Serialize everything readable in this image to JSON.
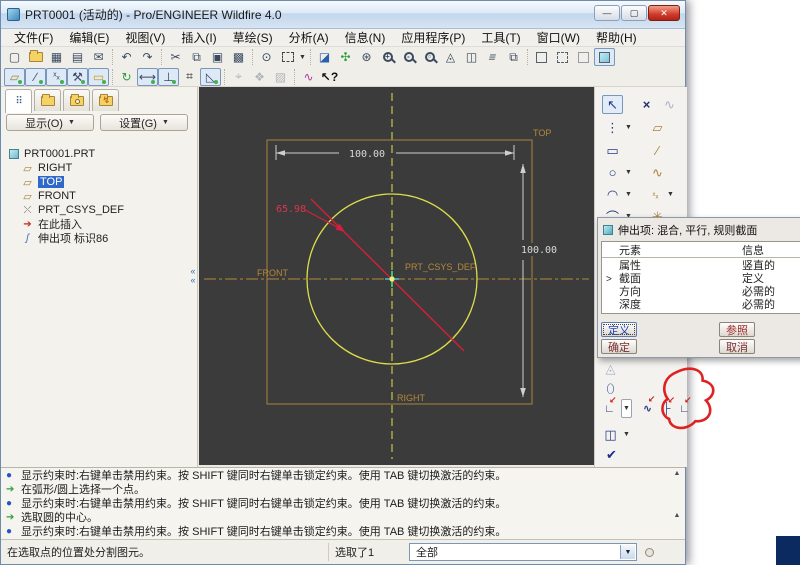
{
  "window": {
    "title": "PRT0001 (活动的) - Pro/ENGINEER Wildfire 4.0"
  },
  "menu": {
    "items": [
      "文件(F)",
      "编辑(E)",
      "视图(V)",
      "插入(I)",
      "草绘(S)",
      "分析(A)",
      "信息(N)",
      "应用程序(P)",
      "工具(T)",
      "窗口(W)",
      "帮助(H)"
    ]
  },
  "toolbar_main": {
    "icons": [
      "new",
      "open",
      "save",
      "print",
      "send-mail",
      "undo",
      "redo",
      "cut",
      "copy",
      "paste",
      "paste-special",
      "find",
      "select-box",
      "repaint",
      "spin-center",
      "pick-from-list",
      "zoom-in",
      "zoom-out",
      "refit",
      "reorient",
      "saved-views",
      "layers",
      "view-manager",
      "wireframe",
      "hidden-line",
      "no-hidden",
      "shaded"
    ]
  },
  "toolbar_datum": {
    "icons": [
      "datum-planes-toggle",
      "datum-axes-toggle",
      "datum-points-toggle",
      "csys-toggle",
      "annotation-toggle",
      "sketch-orient",
      "dimension-display-toggle",
      "constraint-display-toggle",
      "grid-toggle",
      "vertex-display-toggle",
      "disabled-tool-1",
      "disabled-tool-2",
      "disabled-tool-3",
      "sketcher-palette",
      "context-help"
    ]
  },
  "navigator": {
    "tabs": [
      "model-tree",
      "folder-browser",
      "favorites",
      "connections"
    ],
    "show_button": "显示(O)",
    "settings_button": "设置(G)",
    "tree": [
      {
        "label": "PRT0001.PRT",
        "icon": "part"
      },
      {
        "label": "RIGHT",
        "icon": "datum-plane"
      },
      {
        "label": "TOP",
        "icon": "datum-plane",
        "selected": true
      },
      {
        "label": "FRONT",
        "icon": "datum-plane"
      },
      {
        "label": "PRT_CSYS_DEF",
        "icon": "csys"
      },
      {
        "label": "在此插入",
        "icon": "insert-here"
      },
      {
        "label": "伸出项 标识86",
        "icon": "protrusion"
      }
    ]
  },
  "sketch": {
    "dim_width": "100.00",
    "dim_height": "100.00",
    "dim_diagonal": "65.98",
    "label_top": "TOP",
    "label_front": "FRONT",
    "label_right": "RIGHT",
    "label_csys": "PRT_CSYS_DEF",
    "colors": {
      "background": "#3b3b3b",
      "sketch_yellow": "#dede4a",
      "reference_orange": "#a8833e",
      "dimension_gray": "#d9d9d9",
      "highlight_red": "#d41f3c"
    }
  },
  "sketcher_toolbar": {
    "icons": [
      "select",
      "delete-segment",
      "spline-disabled",
      "line",
      "datum-plane",
      "rectangle",
      "datum-axis",
      "circle",
      "spline",
      "arc",
      "datum-points",
      "fillet",
      "axis-point",
      "text-disabled",
      "ellipse",
      "trim",
      "trim-delete-segment",
      "trim-corner",
      "trim-divide",
      "mirror",
      "accept"
    ]
  },
  "dialog": {
    "title": "伸出项: 混合, 平行, 规则截面",
    "columns": {
      "element": "元素",
      "info": "信息"
    },
    "rows": [
      {
        "element": "属性",
        "info": "竖直的",
        "marker": ""
      },
      {
        "element": "截面",
        "info": "定义",
        "marker": ">"
      },
      {
        "element": "方向",
        "info": "必需的",
        "marker": ""
      },
      {
        "element": "深度",
        "info": "必需的",
        "marker": ""
      }
    ],
    "buttons": {
      "define": "定义",
      "refs": "参照",
      "ok": "确定",
      "cancel": "取消"
    }
  },
  "messages": {
    "lines": [
      {
        "bullet": "dot",
        "text": "显示约束时:右键单击禁用约束。按 SHIFT 键同时右键单击锁定约束。使用 TAB 键切换激活的约束。"
      },
      {
        "bullet": "arrow",
        "text": "在弧形/圆上选择一个点。"
      },
      {
        "bullet": "dot",
        "text": "显示约束时:右键单击禁用约束。按 SHIFT 键同时右键单击锁定约束。使用 TAB 键切换激活的约束。"
      },
      {
        "bullet": "arrow",
        "text": "选取圆的中心。"
      },
      {
        "bullet": "dot",
        "text": "显示约束时:右键单击禁用约束。按 SHIFT 键同时右键单击锁定约束。使用 TAB 键切换激活的约束。"
      }
    ]
  },
  "statusbar": {
    "message": "在选取点的位置处分割图元。",
    "selection": "选取了1",
    "filter": "全部"
  }
}
